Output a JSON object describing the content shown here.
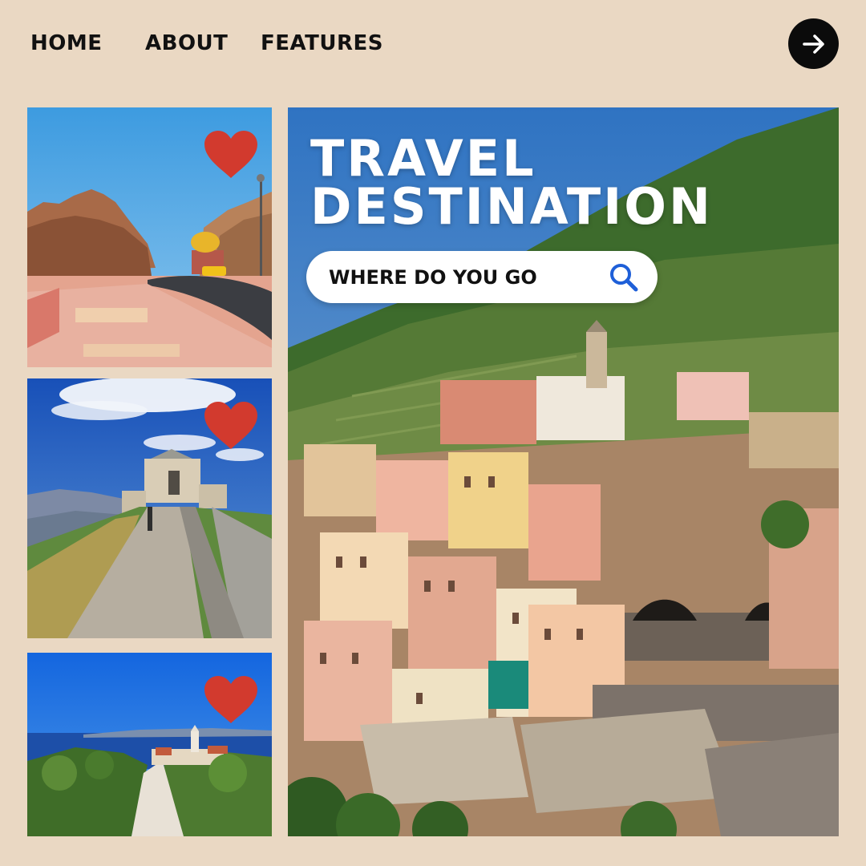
{
  "nav": {
    "home": "HOME",
    "about": "ABOUT",
    "features": "FEATURES",
    "next_icon": "arrow-right-icon"
  },
  "hero": {
    "title_line1": "TRAVEL",
    "title_line2": "DESTINATION",
    "search_placeholder": "WHERE DO YOU GO",
    "search_icon": "search-icon"
  },
  "cards": [
    {
      "icon": "heart-icon"
    },
    {
      "icon": "heart-icon"
    },
    {
      "icon": "heart-icon"
    }
  ],
  "colors": {
    "background": "#ead8c3",
    "heart": "#d23a2e",
    "search_icon": "#1e5fd8",
    "nav_button": "#0b0b0b"
  }
}
